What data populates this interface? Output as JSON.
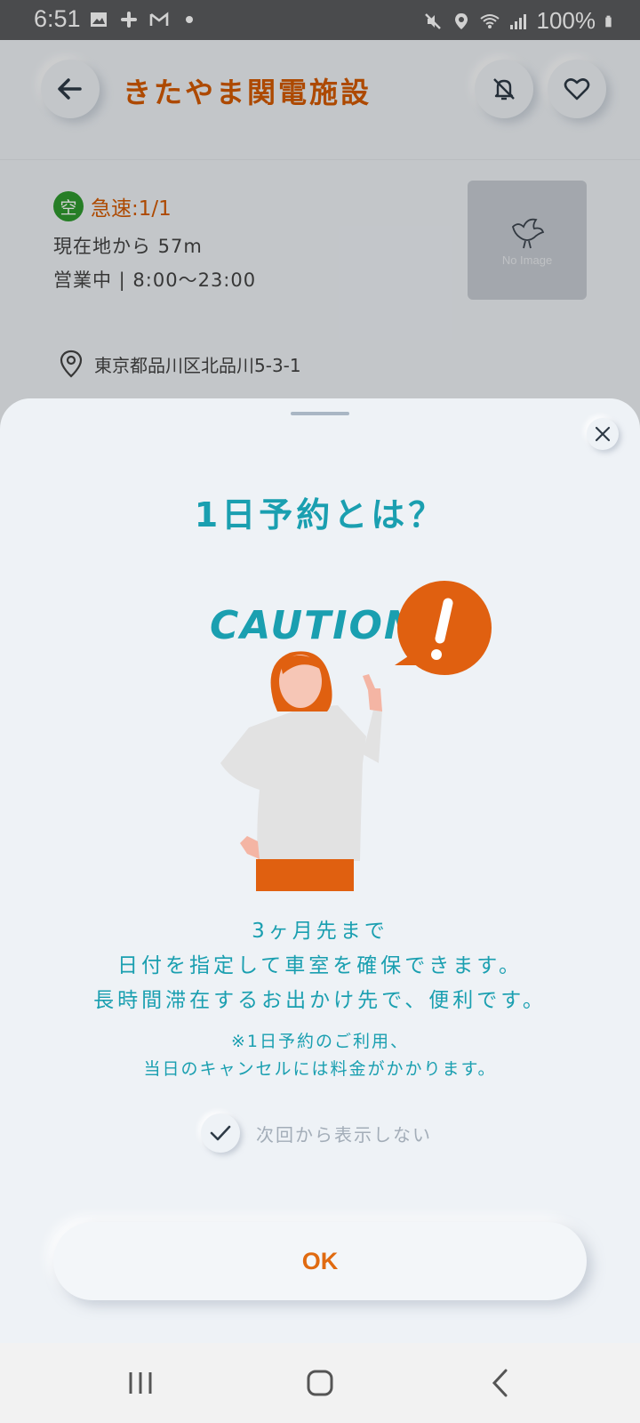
{
  "status_bar": {
    "time": "6:51",
    "battery": "100%"
  },
  "page": {
    "title": "きたやま関電施設",
    "vacancy_badge": "空",
    "charge_status": "急速:1/1",
    "distance": "現在地から 57m",
    "hours": "営業中 | 8:00～23:00",
    "no_image": "No Image",
    "address": "東京都品川区北品川5-3-1"
  },
  "sheet": {
    "title": "1日予約とは？",
    "caution_text": "CAUTION",
    "description_lines": [
      "3ヶ月先まで",
      "日付を指定して車室を確保できます。",
      "長時間滞在するお出かけ先で、便利です。"
    ],
    "note_lines": [
      "※1日予約のご利用、",
      "当日のキャンセルには料金がかかります。"
    ],
    "dont_show_label": "次回から表示しない",
    "ok_label": "OK"
  },
  "colors": {
    "accent_orange": "#d45a00",
    "teal": "#1a9fb0",
    "vacant_green": "#2f9a2f"
  }
}
